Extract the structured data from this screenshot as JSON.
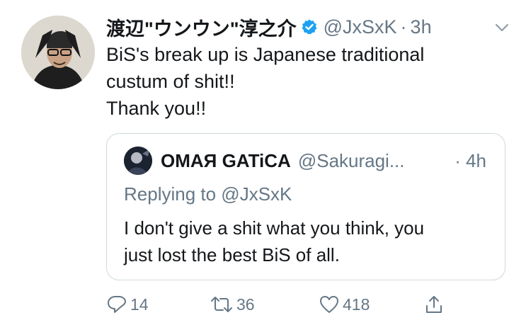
{
  "tweet": {
    "display_name": "渡辺\"ウンウン\"淳之介",
    "handle": "@JxSxK",
    "separator": "·",
    "time": "3h",
    "text_lines": [
      "BiS's break up is Japanese traditional",
      "custum of shit!!",
      "Thank you!!"
    ]
  },
  "quote": {
    "display_name": "OMAЯ GATiCA",
    "handle": "@Sakuragi...",
    "time": "· 4h",
    "reply_to": "Replying to @JxSxK",
    "text_lines": [
      "I don't give a shit what you think, you",
      "just lost the best BiS of all."
    ]
  },
  "actions": {
    "reply_count": "14",
    "retweet_count": "36",
    "like_count": "418"
  },
  "icons": {
    "verified": "verified-badge-icon",
    "menu": "chevron-down-icon",
    "reply": "reply-icon",
    "retweet": "retweet-icon",
    "like": "heart-icon",
    "share": "share-icon"
  },
  "colors": {
    "text": "#14171a",
    "secondary": "#657786",
    "verified": "#1da1f2",
    "border": "#cfd9de"
  }
}
